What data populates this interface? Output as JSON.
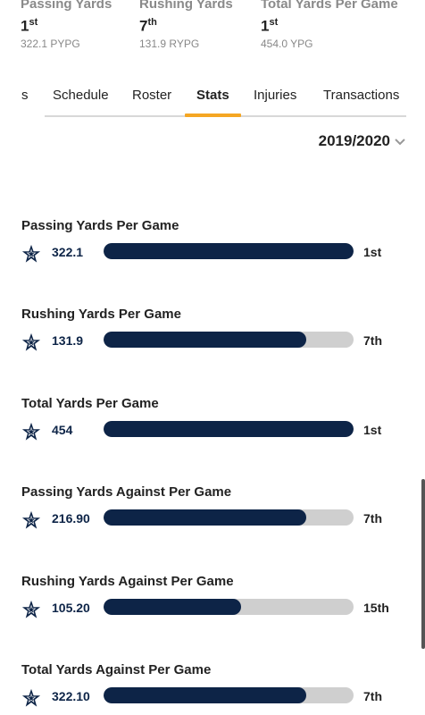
{
  "top_stats": [
    {
      "label": "Passing Yards",
      "rank_num": "1",
      "rank_suffix": "st",
      "sub": "322.1 PYPG"
    },
    {
      "label": "Rushing Yards",
      "rank_num": "7",
      "rank_suffix": "th",
      "sub": "131.9 RYPG"
    },
    {
      "label": "Total Yards Per Game",
      "rank_num": "1",
      "rank_suffix": "st",
      "sub": "454.0 YPG"
    }
  ],
  "tabs": [
    {
      "label": "s"
    },
    {
      "label": "Schedule"
    },
    {
      "label": "Roster"
    },
    {
      "label": "Stats",
      "active": true
    },
    {
      "label": "Injuries"
    },
    {
      "label": "Transactions"
    }
  ],
  "season": {
    "label": "2019/2020"
  },
  "stats": [
    {
      "title": "Passing Yards Per Game",
      "value": "322.1",
      "rank": "1st",
      "fill_fraction": 1.0
    },
    {
      "title": "Rushing Yards Per Game",
      "value": "131.9",
      "rank": "7th",
      "fill_fraction": 0.81
    },
    {
      "title": "Total Yards Per Game",
      "value": "454",
      "rank": "1st",
      "fill_fraction": 1.0
    },
    {
      "title": "Passing Yards Against Per Game",
      "value": "216.90",
      "rank": "7th",
      "fill_fraction": 0.81
    },
    {
      "title": "Rushing Yards Against Per Game",
      "value": "105.20",
      "rank": "15th",
      "fill_fraction": 0.55
    },
    {
      "title": "Total Yards Against Per Game",
      "value": "322.10",
      "rank": "7th",
      "fill_fraction": 0.81
    }
  ],
  "colors": {
    "navy": "#0d2447",
    "track": "#cfcfcf",
    "accent": "#f5a623"
  },
  "icons": {
    "team": "star-icon",
    "season_dropdown": "chevron-down-icon"
  }
}
